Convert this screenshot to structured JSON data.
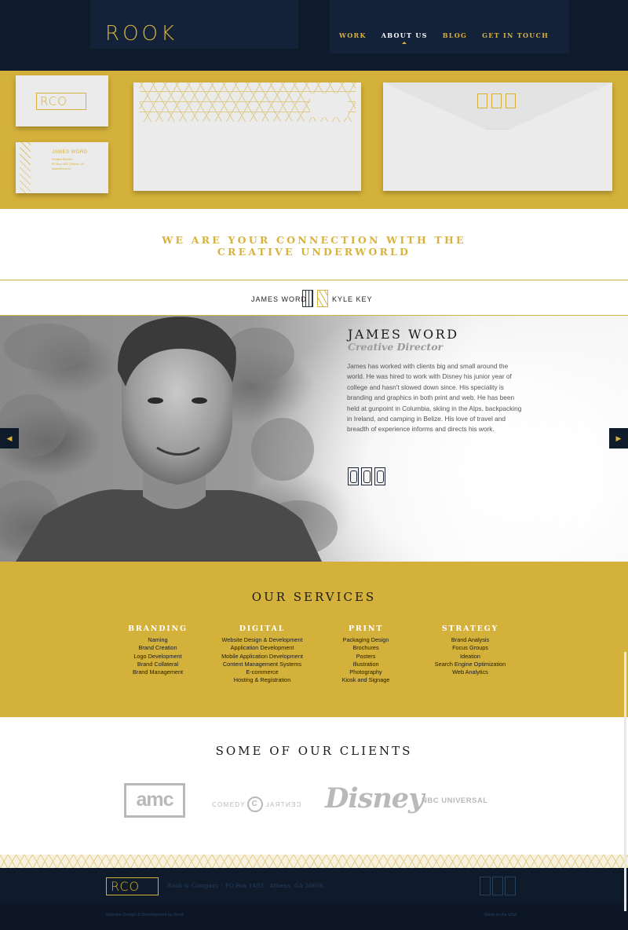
{
  "header": {
    "logo": "ROOK",
    "nav": [
      "WORK",
      "ABOUT US",
      "BLOG",
      "GET IN TOUCH"
    ],
    "active_nav": "ABOUT US"
  },
  "stationery": {
    "card_logo": "RCO",
    "card_name": "JAMES WORD",
    "card_title": "Creative Director",
    "card_address": "PO Box 1493 | Athens, GA",
    "card_email": "james@rook.co"
  },
  "tagline": {
    "line1": "WE ARE YOUR CONNECTION WITH THE",
    "line2": "CREATIVE UNDERWORLD"
  },
  "team": {
    "left_name": "JAMES WORD",
    "right_name": "KYLE KEY"
  },
  "profile": {
    "name": "JAMES WORD",
    "role": "Creative Director",
    "bio": "James has worked with clients big and small around the world. He was hired to work with Disney his junior year of college and hasn't slowed down since. His speciality is branding and graphics in both print and web. He has been held at gunpoint in Columbia, skiing in the Alps, backpacking in Ireland, and camping in Belize. His love of travel and breadth of experience informs and directs his work.",
    "prev_arrow": "◀",
    "next_arrow": "▶"
  },
  "services": {
    "title": "OUR SERVICES",
    "columns": [
      {
        "heading": "BRANDING",
        "items": [
          "Naming",
          "Brand Creation",
          "Logo Development",
          "Brand Collateral",
          "Brand Management"
        ]
      },
      {
        "heading": "DIGITAL",
        "items": [
          "Website Design & Development",
          "Application Development",
          "Mobile Application Development",
          "Content Management Systems",
          "E-commerce",
          "Hosting & Registration"
        ]
      },
      {
        "heading": "PRINT",
        "items": [
          "Packaging Design",
          "Brochures",
          "Posters",
          "Illustration",
          "Photography",
          "Kiosk and Signage"
        ]
      },
      {
        "heading": "STRATEGY",
        "items": [
          "Brand Analysis",
          "Focus Groups",
          "Ideation",
          "Search Engine Optimization",
          "Web Analytics"
        ]
      }
    ]
  },
  "clients": {
    "title": "SOME OF OUR CLIENTS",
    "amc": "amc",
    "comedy_left": "COMEDY",
    "comedy_mark": "C",
    "comedy_right": "CENTRAL",
    "disney": "Disney",
    "nbc": "NBC UNIVERSAL"
  },
  "footer": {
    "logo": "RCO",
    "address": "Rook & Company · PO Box 1493 · Athens, GA 30606",
    "credit": "Website Design & Development by Rook",
    "made": "Made in the USA"
  },
  "colors": {
    "navy": "#0f1a2b",
    "gold": "#d4b13a"
  }
}
